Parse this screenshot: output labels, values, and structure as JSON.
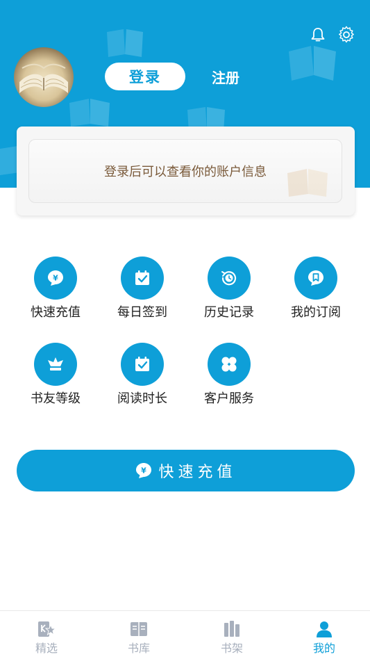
{
  "colors": {
    "accent": "#0e9fd8",
    "card_text": "#7a5a3a",
    "tab_inactive": "#a8b0bd"
  },
  "header": {
    "bell_icon": "bell-icon",
    "gear_icon": "gear-icon",
    "avatar": "book-avatar",
    "login_label": "登录",
    "register_label": "注册"
  },
  "account_card": {
    "message": "登录后可以查看你的账户信息"
  },
  "grid": {
    "items": [
      {
        "label": "快速充值",
        "icon": "yen-icon"
      },
      {
        "label": "每日签到",
        "icon": "calendar-check-icon"
      },
      {
        "label": "历史记录",
        "icon": "history-clock-icon"
      },
      {
        "label": "我的订阅",
        "icon": "bookmark-icon"
      },
      {
        "label": "书友等级",
        "icon": "crown-icon"
      },
      {
        "label": "阅读时长",
        "icon": "calendar-check-icon"
      },
      {
        "label": "客户服务",
        "icon": "clover-icon"
      }
    ]
  },
  "recharge": {
    "label": "快速充值",
    "icon": "yen-icon"
  },
  "tabbar": {
    "items": [
      {
        "label": "精选",
        "icon": "featured-icon"
      },
      {
        "label": "书库",
        "icon": "library-icon"
      },
      {
        "label": "书架",
        "icon": "bookshelf-icon"
      },
      {
        "label": "我的",
        "icon": "profile-icon",
        "active": true
      }
    ]
  }
}
